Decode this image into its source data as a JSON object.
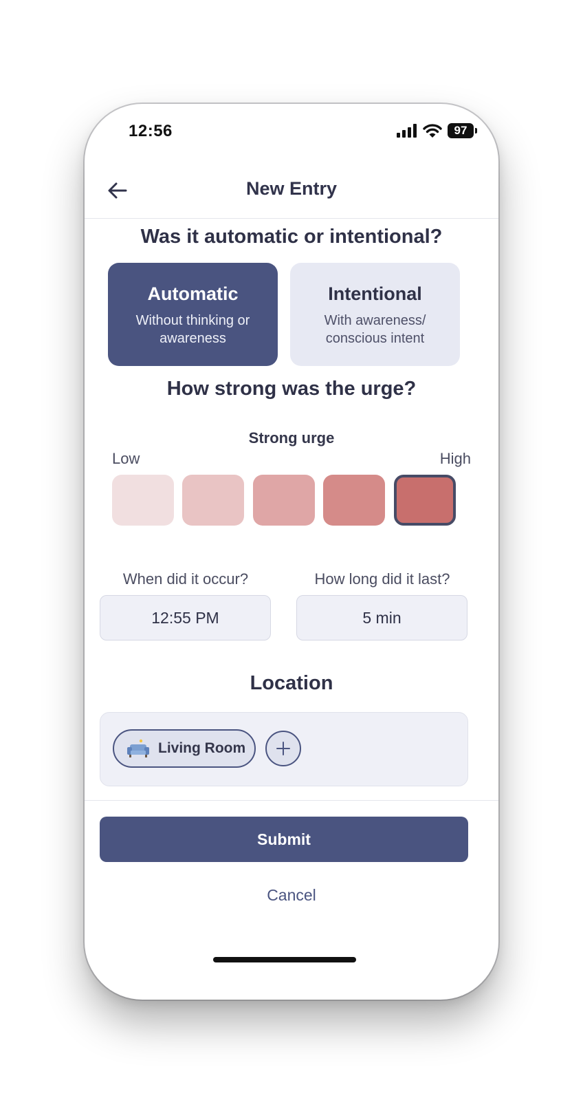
{
  "status_bar": {
    "time": "12:56",
    "battery": "97"
  },
  "header": {
    "title": "New Entry"
  },
  "type_question": {
    "title": "Was it automatic or intentional?",
    "options": [
      {
        "label": "Automatic",
        "description": "Without thinking or awareness",
        "selected": true
      },
      {
        "label": "Intentional",
        "description": "With awareness/ conscious intent",
        "selected": false
      }
    ]
  },
  "urge": {
    "title": "How strong was the urge?",
    "current_label": "Strong urge",
    "low_label": "Low",
    "high_label": "High",
    "levels": 5,
    "selected_level": 5,
    "colors": [
      "#f1dfe0",
      "#e9c4c4",
      "#dfa6a6",
      "#d58b89",
      "#c86f6d"
    ]
  },
  "timing": {
    "when_label": "When did it occur?",
    "when_value": "12:55 PM",
    "duration_label": "How long did it last?",
    "duration_value": "5 min"
  },
  "location": {
    "title": "Location",
    "chips": [
      {
        "icon": "couch-icon",
        "label": "Living Room"
      }
    ],
    "add_icon": "plus-icon"
  },
  "actions": {
    "submit_label": "Submit",
    "cancel_label": "Cancel"
  },
  "theme": {
    "accent": "#4a5480",
    "text": "#2f3147"
  }
}
